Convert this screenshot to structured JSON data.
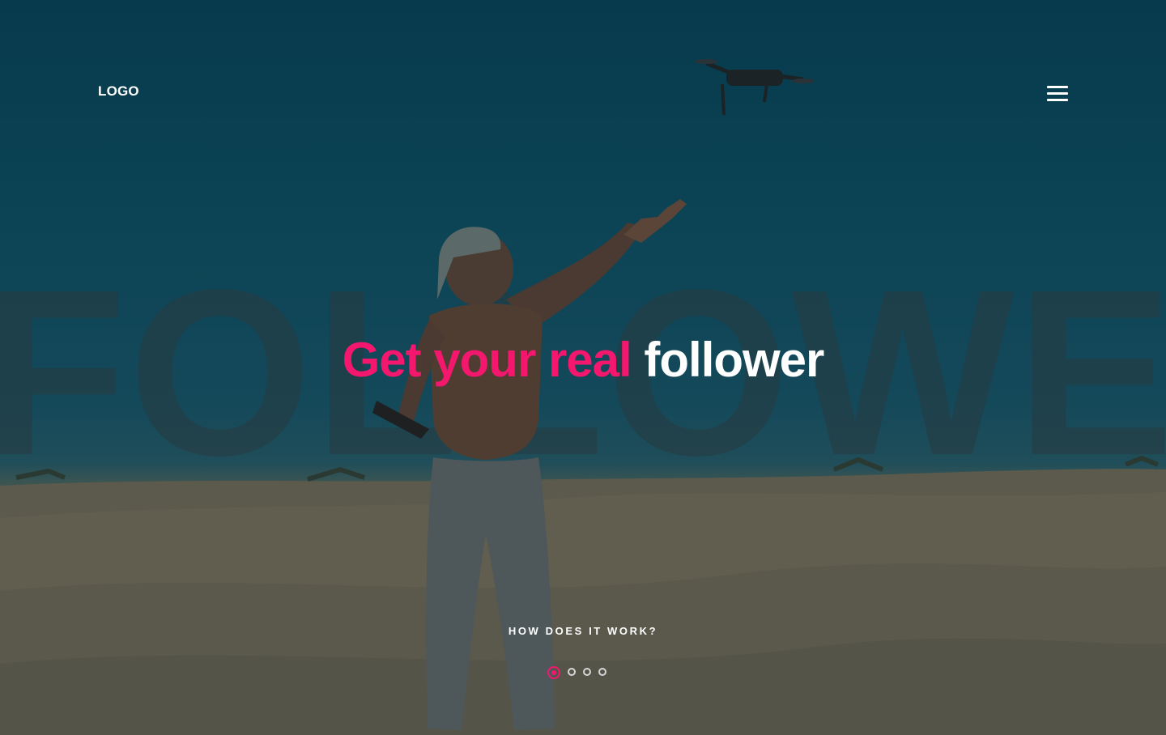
{
  "header": {
    "logo": "LOGO",
    "menu_icon": "hamburger-menu-icon"
  },
  "hero": {
    "watermark": "FOLLOWER",
    "headline_accent": "Get your real",
    "headline_plain": "follower",
    "cta": "HOW DOES IT WORK?"
  },
  "slider": {
    "total": 4,
    "active_index": 0
  },
  "colors": {
    "accent": "#f4176e",
    "text": "#ffffff",
    "overlay": "#0c4455"
  }
}
